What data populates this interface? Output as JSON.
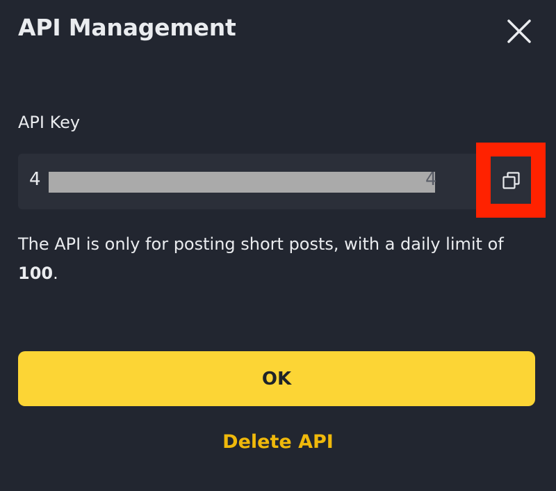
{
  "dialog": {
    "title": "API Management",
    "close_icon": "close-icon"
  },
  "api_key": {
    "label": "API Key",
    "value_first_char": "4",
    "value_last_char": "4",
    "masked": true,
    "copy_icon": "copy-icon"
  },
  "info": {
    "text_before": "The API is only for posting short posts, with a daily limit of ",
    "limit": "100",
    "text_after": "."
  },
  "actions": {
    "ok_label": "OK",
    "delete_label": "Delete API"
  },
  "colors": {
    "background": "#222630",
    "input_background": "#2b2f39",
    "primary": "#fcd535",
    "link": "#f0b90b",
    "highlight": "#ff2200"
  }
}
